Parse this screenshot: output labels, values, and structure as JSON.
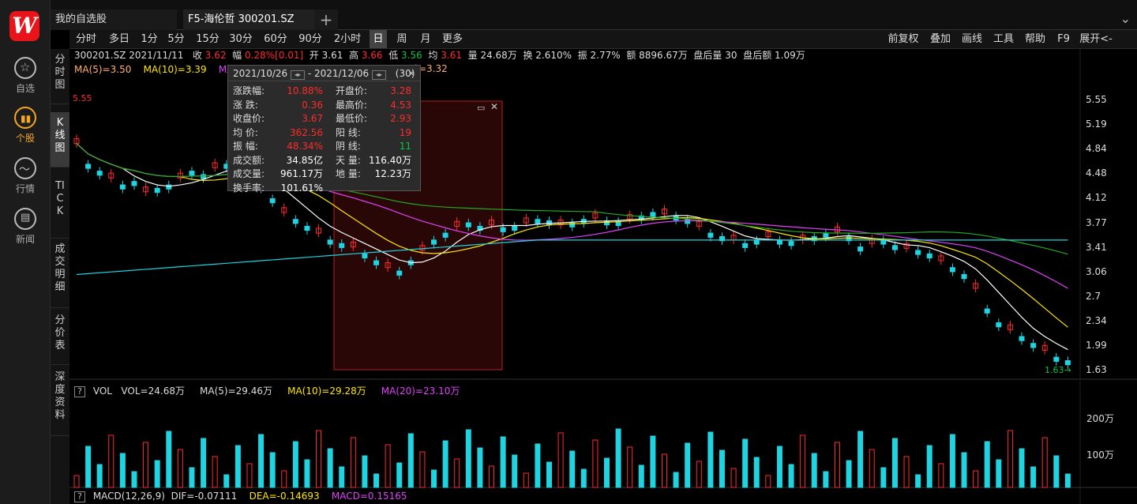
{
  "app": {
    "logo_letter": "W",
    "nav": [
      {
        "label": "自选",
        "icon": "star-icon"
      },
      {
        "label": "个股",
        "icon": "chart-icon"
      },
      {
        "label": "行情",
        "icon": "trend-icon"
      },
      {
        "label": "新闻",
        "icon": "news-icon"
      }
    ]
  },
  "tabs": [
    {
      "label": "我的自选股"
    },
    {
      "label": "F5-海伦哲 300201.SZ"
    }
  ],
  "toolbar": {
    "periods": [
      "分时",
      "多日",
      "1分",
      "5分",
      "15分",
      "30分",
      "60分",
      "90分",
      "2小时",
      "日",
      "周",
      "月",
      "更多"
    ],
    "selected_period": "日",
    "right": [
      "前复权",
      "叠加",
      "画线",
      "工具",
      "帮助",
      "F9",
      "展开<-"
    ]
  },
  "vertical_tabs": [
    "分时图",
    "K线图",
    "TICK",
    "成交明细",
    "分价表",
    "深度资料"
  ],
  "quote": {
    "code_date": "300201.SZ 2021/11/11",
    "close_label": "收",
    "close": "3.62",
    "amp_label": "幅",
    "change": "0.28%[0.01]",
    "open_label": "开",
    "open": "3.61",
    "high_label": "高",
    "high": "3.66",
    "low_label": "低",
    "low": "3.56",
    "avg_label": "均",
    "avg": "3.61",
    "vol_label": "量",
    "vol": "24.68万",
    "turn_label": "换",
    "turn": "2.610%",
    "zhen_label": "振",
    "zhen": "2.77%",
    "amount_label": "额",
    "amount": "8896.67万",
    "after_vol_label": "盘后量",
    "after_vol": "30",
    "after_amt_label": "盘后额",
    "after_amt": "1.09万"
  },
  "ma_line": {
    "ma5": "MA(5)=3.50",
    "ma10": "MA(10)=3.39",
    "ma20": "MA(20)",
    "ma60": "50)=3.32"
  },
  "price_axis": [
    "5.55",
    "5.19",
    "4.84",
    "4.48",
    "4.12",
    "3.77",
    "3.41",
    "3.06",
    "2.7",
    "2.34",
    "1.99",
    "1.63"
  ],
  "chart_marks": {
    "high_label": "5.55",
    "low_label": "1.63→"
  },
  "popup": {
    "date_range": "2021/10/26",
    "date_end": "- 2021/12/06",
    "count": "(30)",
    "rows": [
      {
        "l1": "涨跌幅:",
        "v1": "10.88%",
        "l2": "开盘价:",
        "v2": "3.28"
      },
      {
        "l1": "涨    跌:",
        "v1": "0.36",
        "l2": "最高价:",
        "v2": "4.53"
      },
      {
        "l1": "收盘价:",
        "v1": "3.67",
        "l2": "最低价:",
        "v2": "2.93"
      },
      {
        "l1": "均    价:",
        "v1": "362.56",
        "l2": "阳    线:",
        "v2": "19"
      },
      {
        "l1": "振    幅:",
        "v1": "48.34%",
        "l2": "阴    线:",
        "v2": "11"
      },
      {
        "l1": "成交额:",
        "v1": "34.85亿",
        "l2": "天    量:",
        "v2": "116.40万"
      },
      {
        "l1": "成交量:",
        "v1": "961.17万",
        "l2": "地    量:",
        "v2": "12.23万"
      },
      {
        "l1": "换手率:",
        "v1": "101.61%",
        "l2": "",
        "v2": ""
      }
    ]
  },
  "vol_panel": {
    "q": "?",
    "name": "VOL",
    "vol": "VOL=24.68万",
    "ma5": "MA(5)=29.46万",
    "ma10": "MA(10)=29.28万",
    "ma20": "MA(20)=23.10万",
    "axis": [
      "200万",
      "100万"
    ]
  },
  "macd_panel": {
    "q": "?",
    "name": "MACD(12,26,9)",
    "dif": "DIF=-0.07111",
    "dea": "DEA=-0.14693",
    "macd": "MACD=0.15165"
  },
  "colors": {
    "up": "#ff2a2a",
    "down": "#1fd3e0",
    "ma5": "#ffffff",
    "ma10": "#ffe600",
    "ma20": "#e040fb",
    "ma60": "#22aa22",
    "ma120": "#1fd3e0",
    "bg": "#000000"
  }
}
